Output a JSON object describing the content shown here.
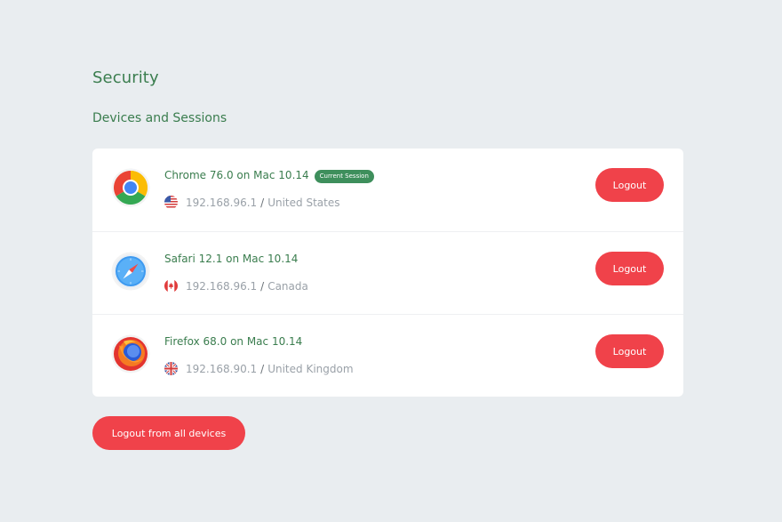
{
  "page": {
    "title": "Security",
    "section_title": "Devices and Sessions"
  },
  "sessions": [
    {
      "browser": "Chrome",
      "icon": "chrome-icon",
      "title": "Chrome 76.0 on Mac 10.14",
      "badge": "Current Session",
      "ip": "192.168.96.1",
      "separator": "/",
      "location": "United States",
      "flag": "us-flag-icon",
      "logout_label": "Logout"
    },
    {
      "browser": "Safari",
      "icon": "safari-icon",
      "title": "Safari 12.1 on Mac 10.14",
      "ip": "192.168.96.1",
      "separator": "/",
      "location": "Canada",
      "flag": "canada-flag-icon",
      "logout_label": "Logout"
    },
    {
      "browser": "Firefox",
      "icon": "firefox-icon",
      "title": "Firefox 68.0 on Mac 10.14",
      "ip": "192.168.90.1",
      "separator": "/",
      "location": "United Kingdom",
      "flag": "uk-flag-icon",
      "logout_label": "Logout"
    }
  ],
  "logout_all_label": "Logout from all devices",
  "colors": {
    "background": "#e9edf0",
    "heading": "#3a7d4e",
    "badge": "#3e8f5c",
    "danger": "#f0424a",
    "muted": "#9aa1a8"
  }
}
